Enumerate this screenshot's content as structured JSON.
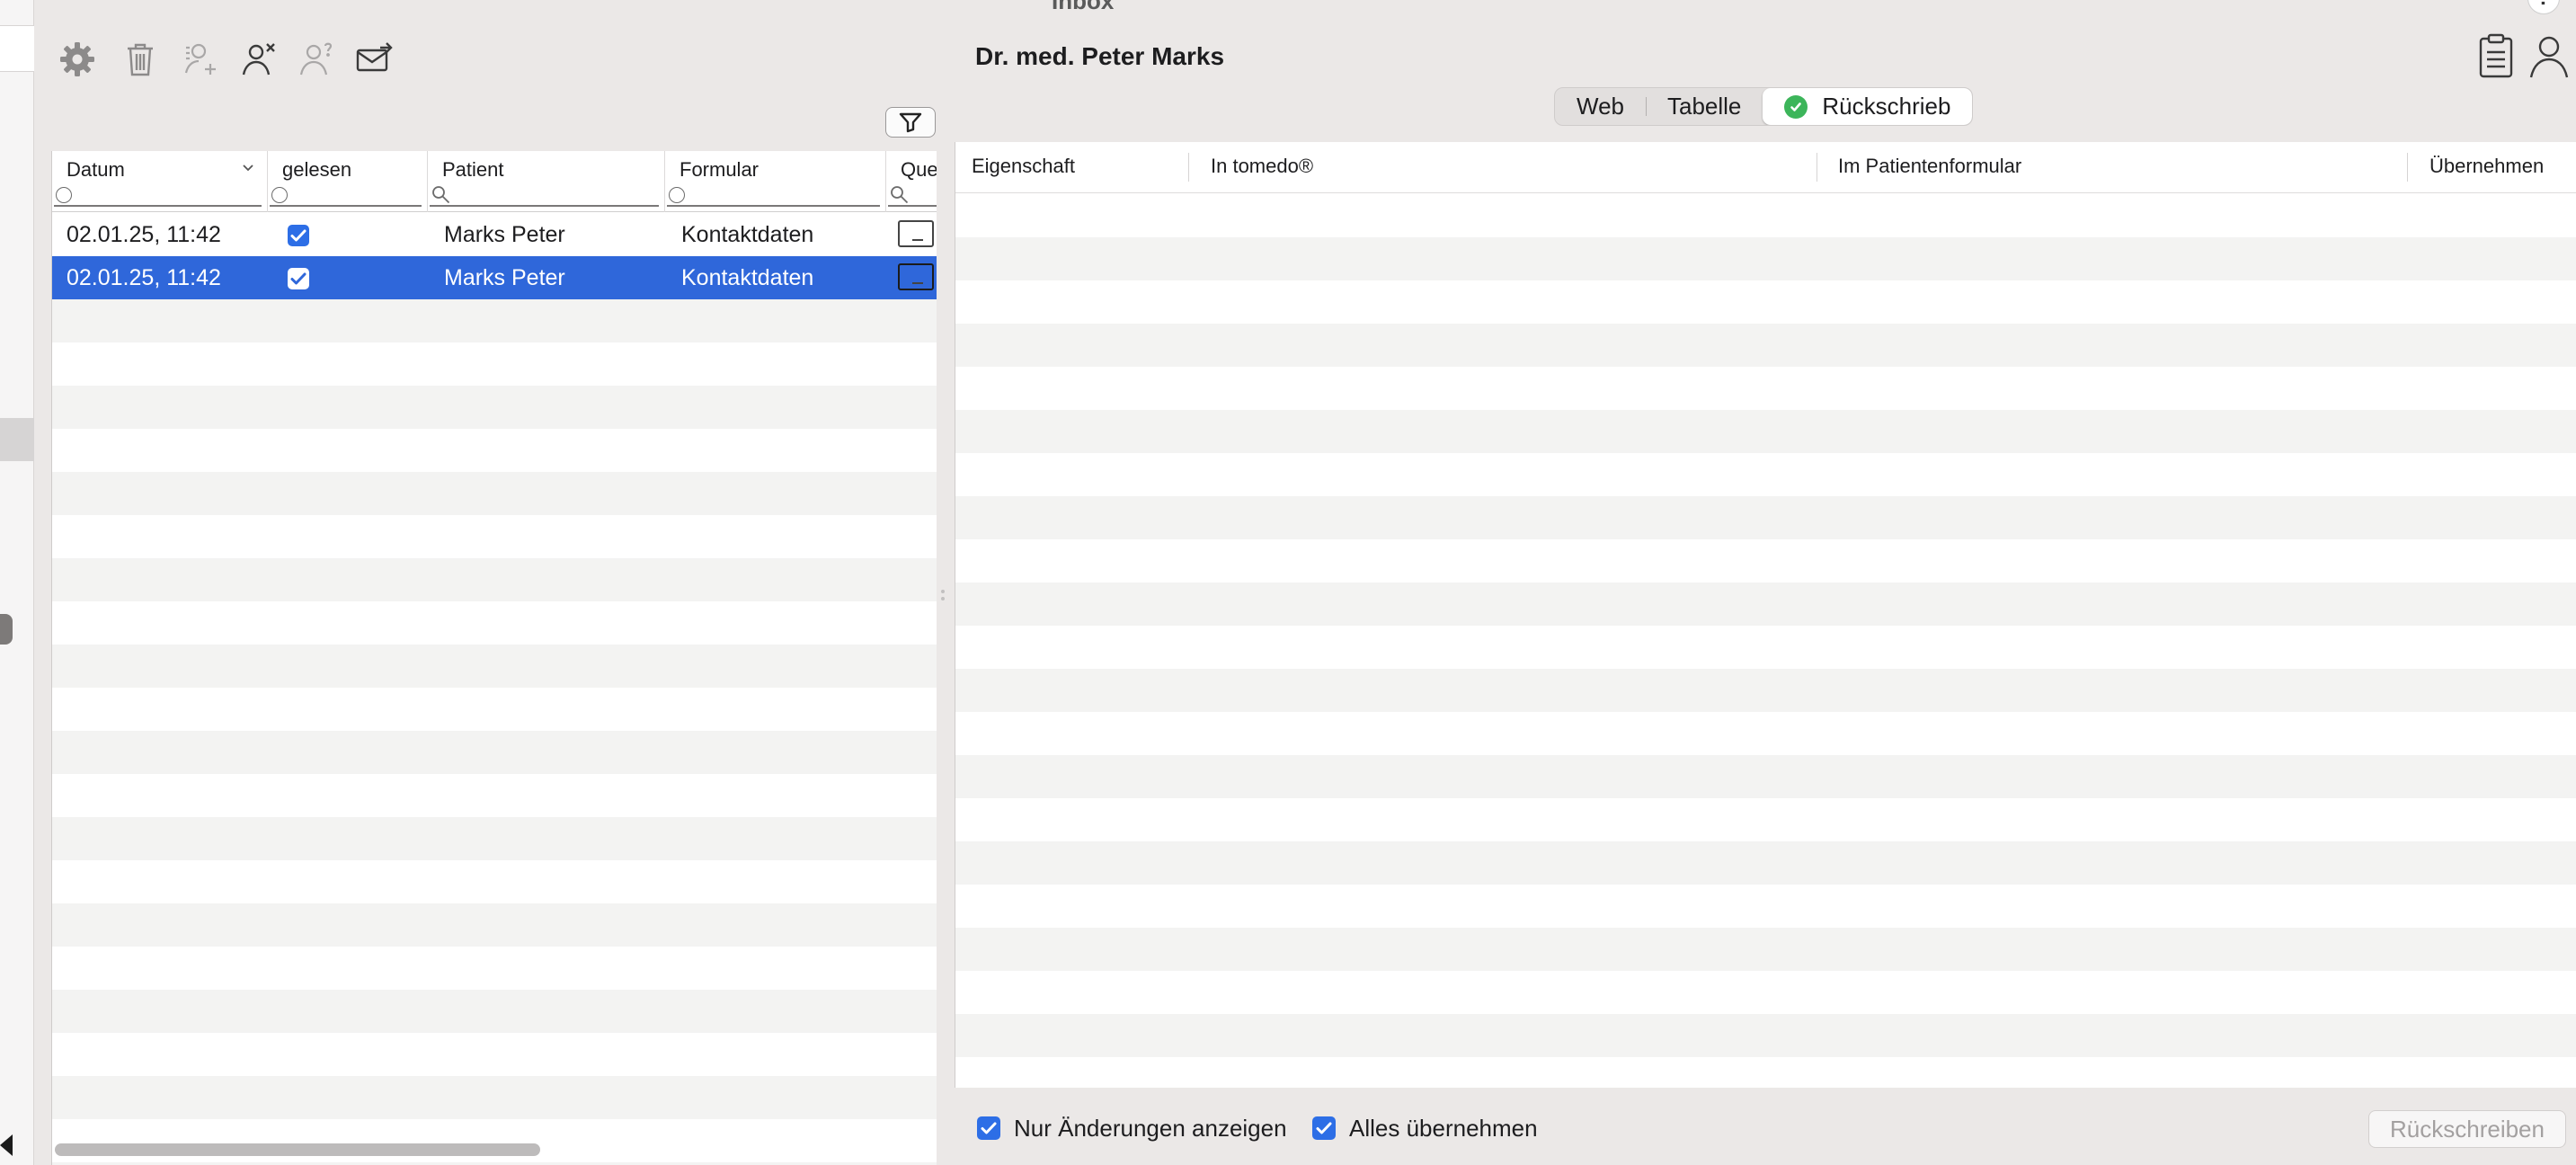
{
  "window": {
    "title": "Inbox",
    "help_label": "?"
  },
  "toolbar": {
    "icons": [
      "gear-icon",
      "trash-icon",
      "assign-patient-icon",
      "remove-patient-icon",
      "unknown-patient-icon",
      "mail-send-icon"
    ]
  },
  "inbox_table": {
    "columns": [
      {
        "label": "Datum",
        "filter": "circle"
      },
      {
        "label": "gelesen",
        "filter": "circle"
      },
      {
        "label": "Patient",
        "filter": "search"
      },
      {
        "label": "Formular",
        "filter": "circle"
      },
      {
        "label": "Que",
        "filter": "search"
      }
    ],
    "rows": [
      {
        "datum": "02.01.25, 11:42",
        "gelesen": true,
        "patient": "Marks Peter",
        "formular": "Kontaktdaten",
        "selected": false
      },
      {
        "datum": "02.01.25, 11:42",
        "gelesen": true,
        "patient": "Marks Peter",
        "formular": "Kontaktdaten",
        "selected": true
      }
    ]
  },
  "detail": {
    "title": "Dr. med. Peter Marks",
    "tabs": [
      {
        "label": "Web",
        "active": false
      },
      {
        "label": "Tabelle",
        "active": false
      },
      {
        "label": "Rückschrieb",
        "active": true,
        "status": "ok"
      }
    ],
    "columns": [
      "Eigenschaft",
      "In tomedo®",
      "Im Patientenformular",
      "Übernehmen"
    ]
  },
  "footer": {
    "only_changes_label": "Nur Änderungen anzeigen",
    "only_changes_checked": true,
    "accept_all_label": "Alles übernehmen",
    "accept_all_checked": true,
    "write_back_label": "Rückschreiben"
  },
  "colors": {
    "selection": "#2f67da",
    "checkbox": "#2d6ee6",
    "status_ok": "#3cb55a",
    "window_bg": "#ebe8e7",
    "stripe": "#f3f3f2"
  }
}
